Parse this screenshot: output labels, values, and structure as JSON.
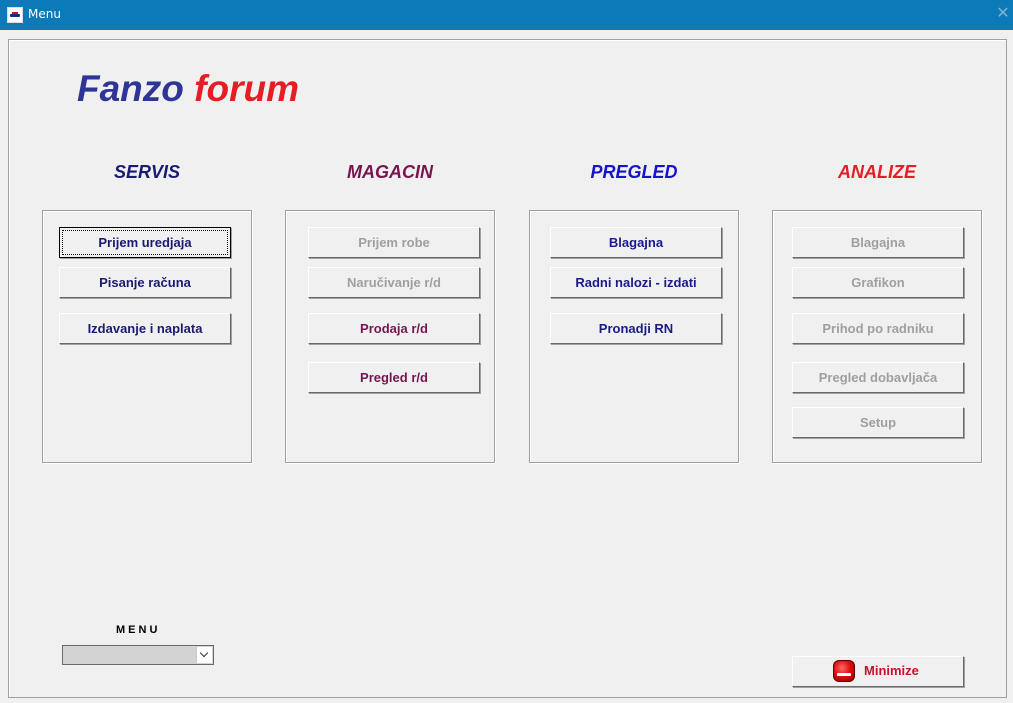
{
  "window": {
    "title": "Menu"
  },
  "brand": {
    "part1": "Fanzo",
    "part2": "forum"
  },
  "columns": {
    "servis": {
      "heading": "SERVIS",
      "heading_color": "#1a1a88",
      "buttons": [
        {
          "label": "Prijem uredjaja",
          "enabled": true,
          "focused": true
        },
        {
          "label": "Pisanje računa",
          "enabled": true
        },
        {
          "label": "Izdavanje i naplata",
          "enabled": true
        }
      ]
    },
    "magacin": {
      "heading": "MAGACIN",
      "heading_color": "#7a1450",
      "buttons": [
        {
          "label": "Prijem robe",
          "enabled": false
        },
        {
          "label": "Naručivanje r/d",
          "enabled": false
        },
        {
          "label": "Prodaja r/d",
          "enabled": true
        },
        {
          "label": "Pregled r/d",
          "enabled": true
        }
      ]
    },
    "pregled": {
      "heading": "PREGLED",
      "heading_color": "#1414c8",
      "buttons": [
        {
          "label": "Blagajna",
          "enabled": true
        },
        {
          "label": "Radni nalozi - izdati",
          "enabled": true
        },
        {
          "label": "Pronadji RN",
          "enabled": true
        }
      ]
    },
    "analize": {
      "heading": "ANALIZE",
      "heading_color": "#e31e24",
      "buttons": [
        {
          "label": "Blagajna",
          "enabled": false
        },
        {
          "label": "Grafikon",
          "enabled": false
        },
        {
          "label": "Prihod po radniku",
          "enabled": false
        },
        {
          "label": "Pregled dobavljača",
          "enabled": false
        },
        {
          "label": "Setup",
          "enabled": false
        }
      ]
    }
  },
  "menu": {
    "label": "MENU",
    "selected": ""
  },
  "minimize": {
    "label": "Minimize",
    "icon": "minimize-icon"
  },
  "colors": {
    "titlebar": "#0c79b8",
    "brand_blue": "#2f3596",
    "brand_red": "#e31e24"
  }
}
